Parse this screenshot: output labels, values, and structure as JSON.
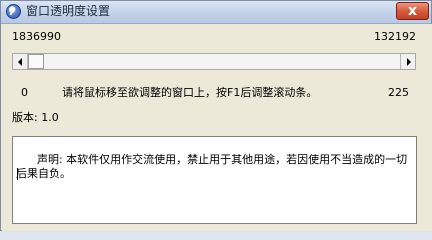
{
  "window": {
    "title": "窗口透明度设置",
    "close_symbol": "x"
  },
  "labels": {
    "top_left_value": "1836990",
    "top_right_value": "132192",
    "slider_min": "0",
    "slider_max": "225",
    "instruction": "请将鼠标移至欲调整的窗口上，按F1后调整滚动条。",
    "version": "版本: 1.0"
  },
  "notice": {
    "text": "声明: 本软件仅用作交流使用，禁止用于其他用途，若因使用不当造成的一切后果自负。"
  },
  "slider": {
    "value": 0
  }
}
